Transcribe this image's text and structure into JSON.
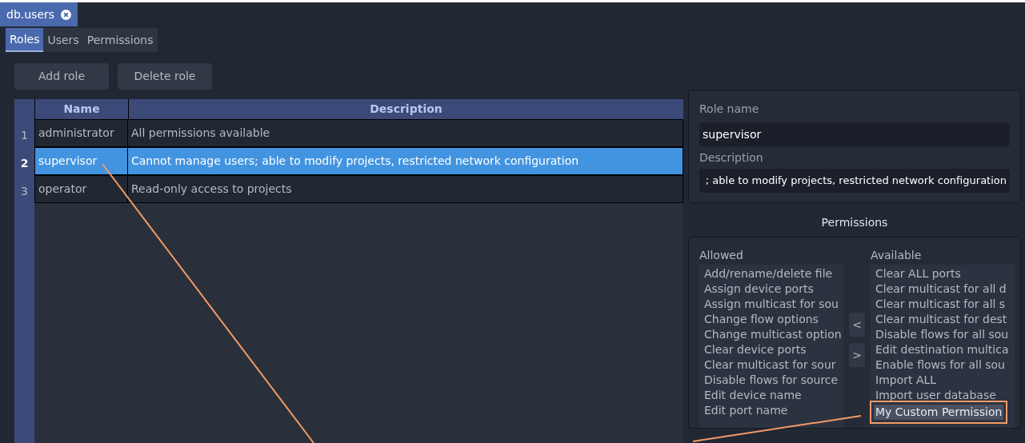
{
  "document_tab": {
    "label": "db.users"
  },
  "tabs": [
    {
      "label": "Roles",
      "selected": true
    },
    {
      "label": "Users",
      "selected": false
    },
    {
      "label": "Permissions",
      "selected": false
    }
  ],
  "toolbar": [
    "Add role",
    "Delete role"
  ],
  "table": {
    "columns": [
      "Name",
      "Description"
    ],
    "rows": [
      {
        "number": "1",
        "name": "administrator",
        "description": "All permissions available",
        "selected": false
      },
      {
        "number": "2",
        "name": "supervisor",
        "description": "Cannot manage users; able to modify projects, restricted network configuration",
        "selected": true
      },
      {
        "number": "3",
        "name": "operator",
        "description": "Read-only access to projects",
        "selected": false
      }
    ]
  },
  "role_form": {
    "name_label": "Role name",
    "name_value": "supervisor",
    "description_label": "Description",
    "description_value": "; able to modify projects, restricted network configuration"
  },
  "permissions": {
    "title": "Permissions",
    "allowed_label": "Allowed",
    "available_label": "Available",
    "move_left": "<",
    "move_right": ">",
    "allowed": [
      {
        "label": "Add/rename/delete file",
        "selected": false
      },
      {
        "label": "Assign device ports",
        "selected": false
      },
      {
        "label": "Assign multicast for sou",
        "selected": false
      },
      {
        "label": "Change flow options",
        "selected": false
      },
      {
        "label": "Change multicast option",
        "selected": false
      },
      {
        "label": "Clear device ports",
        "selected": false
      },
      {
        "label": "Clear multicast for sour",
        "selected": false
      },
      {
        "label": "Disable flows for source",
        "selected": false
      },
      {
        "label": "Edit device name",
        "selected": false
      },
      {
        "label": "Edit port name",
        "selected": false
      }
    ],
    "available": [
      {
        "label": "Clear ALL ports",
        "selected": false
      },
      {
        "label": "Clear multicast for all d",
        "selected": false
      },
      {
        "label": "Clear multicast for all s",
        "selected": false
      },
      {
        "label": "Clear multicast for dest",
        "selected": false
      },
      {
        "label": "Disable flows for all sou",
        "selected": false
      },
      {
        "label": "Edit destination multica",
        "selected": false
      },
      {
        "label": "Enable flows for all sou",
        "selected": false
      },
      {
        "label": "Import ALL",
        "selected": false
      },
      {
        "label": "Import user database",
        "selected": false
      },
      {
        "label": "My Custom Permission",
        "selected": true
      }
    ]
  }
}
